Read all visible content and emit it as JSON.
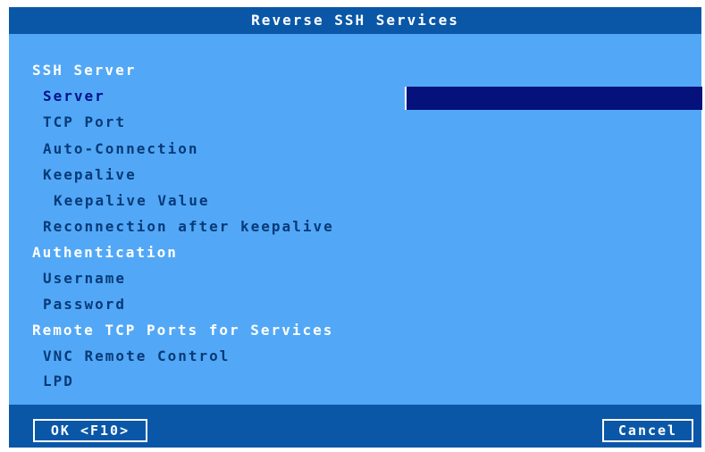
{
  "window": {
    "title": "Reverse SSH Services"
  },
  "menu": {
    "ssh_server": "SSH Server",
    "server": "Server",
    "tcp_port": "TCP Port",
    "auto_connection": "Auto-Connection",
    "keepalive": "Keepalive",
    "keepalive_value": "Keepalive Value",
    "reconnection": "Reconnection after keepalive",
    "authentication": "Authentication",
    "username": "Username",
    "password": "Password",
    "remote_ports": "Remote TCP Ports for Services",
    "vnc": "VNC Remote Control",
    "lpd": "LPD"
  },
  "server_field": {
    "value": ""
  },
  "buttons": {
    "ok": "OK <F10>",
    "cancel": "Cancel"
  },
  "colors": {
    "title_bar": "#0a57a8",
    "panel": "#52a8f6",
    "selected_field": "#06127c",
    "item_text": "#073a78"
  }
}
